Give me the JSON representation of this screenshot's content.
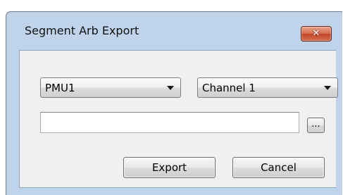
{
  "window": {
    "title": "Segment Arb Export",
    "close_glyph": "✕"
  },
  "form": {
    "device_select": {
      "selected": "PMU1"
    },
    "channel_select": {
      "selected": "Channel 1"
    },
    "file_path": {
      "value": "",
      "placeholder": ""
    },
    "browse_label": "..."
  },
  "buttons": {
    "export_label": "Export",
    "cancel_label": "Cancel"
  },
  "colors": {
    "title_bar": "#bfd3ea",
    "client_area": "#f0f0f0",
    "close_button": "#c94b2e"
  }
}
